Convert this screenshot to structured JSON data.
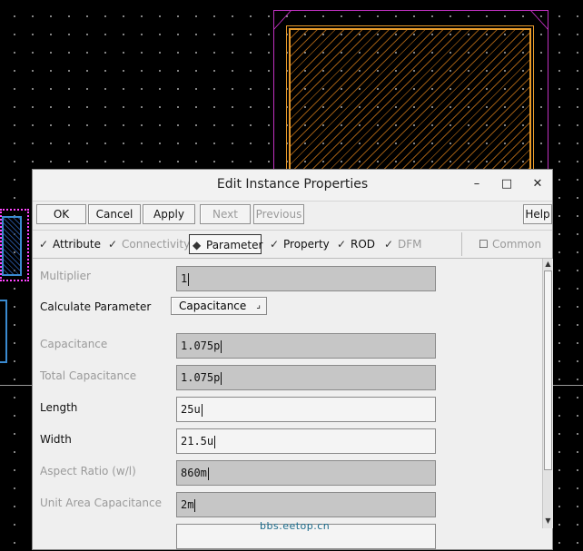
{
  "window": {
    "title": "Edit Instance Properties",
    "controls": {
      "minimize": "–",
      "maximize": "□",
      "close": "✕"
    }
  },
  "buttons": {
    "ok": "OK",
    "cancel": "Cancel",
    "apply": "Apply",
    "next": "Next",
    "previous": "Previous",
    "help": "Help"
  },
  "tabs": [
    {
      "label": "Attribute",
      "state": "enabled",
      "marker": "✓"
    },
    {
      "label": "Connectivity",
      "state": "disabled",
      "marker": "✓"
    },
    {
      "label": "Parameter",
      "state": "selected",
      "marker": "◆"
    },
    {
      "label": "Property",
      "state": "enabled",
      "marker": "✓"
    },
    {
      "label": "ROD",
      "state": "enabled",
      "marker": "✓"
    },
    {
      "label": "DFM",
      "state": "disabled",
      "marker": "✓"
    }
  ],
  "common": {
    "label": "Common",
    "marker": "☐"
  },
  "params": {
    "multiplier": {
      "label": "Multiplier",
      "value": "1"
    },
    "calculate": {
      "label": "Calculate Parameter",
      "selected": "Capacitance",
      "arrow": "⌟"
    },
    "capacitance": {
      "label": "Capacitance",
      "value": "1.075p"
    },
    "total_capacitance": {
      "label": "Total Capacitance",
      "value": "1.075p"
    },
    "length": {
      "label": "Length",
      "value": "25u"
    },
    "width": {
      "label": "Width",
      "value": "21.5u"
    },
    "aspect_ratio": {
      "label": "Aspect Ratio (w/l)",
      "value": "860m"
    },
    "unit_area_cap": {
      "label": "Unit Area Capacitance",
      "value": "2m"
    }
  },
  "scrollbar": {
    "up": "▲",
    "down": "▼"
  },
  "watermark": "bbs.eetop.cn",
  "colors": {
    "canvas": "#000000",
    "grid_dot": "#c8c8c8",
    "cap_outline": "#e89a2a",
    "boundary": "#c030c0",
    "readonly_field": "#c6c6c6"
  }
}
